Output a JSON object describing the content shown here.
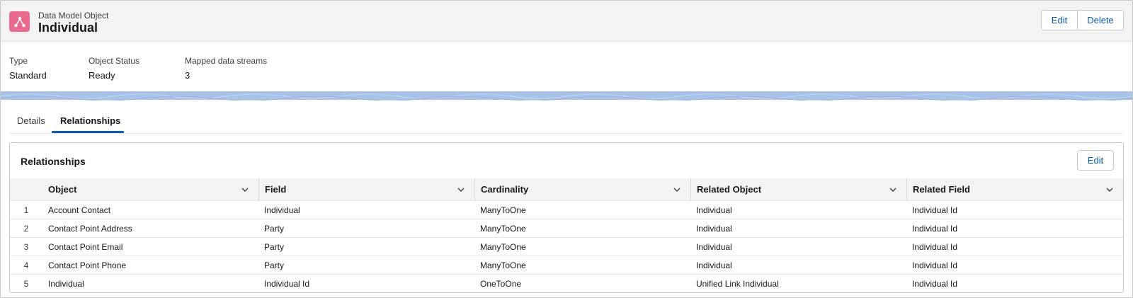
{
  "header": {
    "kicker": "Data Model Object",
    "title": "Individual",
    "icon": "relationship-icon",
    "icon_color": "#e9698f",
    "buttons": {
      "edit": "Edit",
      "delete": "Delete"
    }
  },
  "highlights": [
    {
      "label": "Type",
      "value": "Standard"
    },
    {
      "label": "Object Status",
      "value": "Ready"
    },
    {
      "label": "Mapped data streams",
      "value": "3"
    }
  ],
  "tabs": [
    {
      "label": "Details",
      "active": false
    },
    {
      "label": "Relationships",
      "active": true
    }
  ],
  "card": {
    "title": "Relationships",
    "edit_label": "Edit",
    "columns": [
      "Object",
      "Field",
      "Cardinality",
      "Related Object",
      "Related Field"
    ],
    "rows": [
      {
        "num": "1",
        "object": "Account Contact",
        "field": "Individual",
        "cardinality": "ManyToOne",
        "related_object": "Individual",
        "related_field": "Individual Id"
      },
      {
        "num": "2",
        "object": "Contact Point Address",
        "field": "Party",
        "cardinality": "ManyToOne",
        "related_object": "Individual",
        "related_field": "Individual Id"
      },
      {
        "num": "3",
        "object": "Contact Point Email",
        "field": "Party",
        "cardinality": "ManyToOne",
        "related_object": "Individual",
        "related_field": "Individual Id"
      },
      {
        "num": "4",
        "object": "Contact Point Phone",
        "field": "Party",
        "cardinality": "ManyToOne",
        "related_object": "Individual",
        "related_field": "Individual Id"
      },
      {
        "num": "5",
        "object": "Individual",
        "field": "Individual Id",
        "cardinality": "OneToOne",
        "related_object": "Unified Link Individual",
        "related_field": "Individual Id"
      }
    ]
  },
  "colors": {
    "accent": "#0b5cab",
    "header_bg": "#f3f3f3"
  }
}
